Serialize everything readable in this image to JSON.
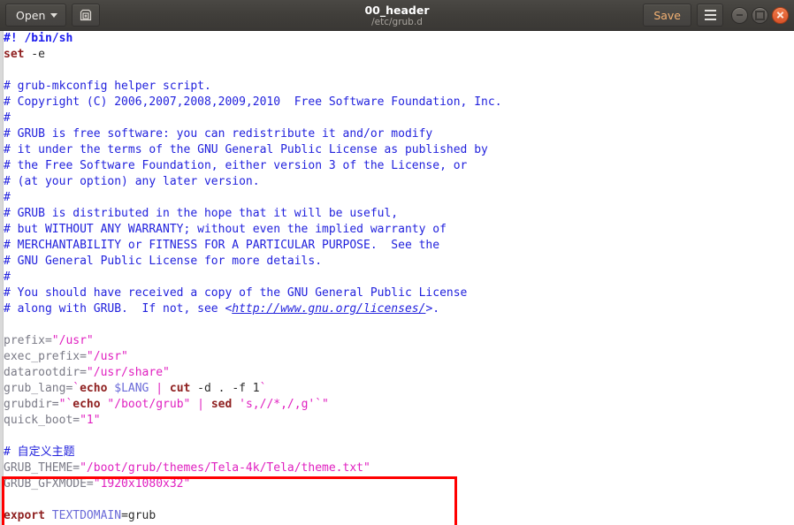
{
  "titlebar": {
    "open_label": "Open",
    "save_label": "Save",
    "title": "00_header",
    "subtitle": "/etc/grub.d",
    "icons": {
      "dropdown": "chevron-down-icon",
      "saveas": "save-as-icon",
      "menu": "hamburger-menu-icon",
      "minimize": "minimize-icon",
      "maximize": "maximize-icon",
      "close": "close-icon"
    }
  },
  "annotation": {
    "color": "#ff0000",
    "shape": "rectangle",
    "note": "highlighted custom theme configuration block"
  },
  "editor": {
    "language": "shell",
    "colors": {
      "comment": "#2222dd",
      "keyword": "#8f2020",
      "string": "#e020c0",
      "variable": "#7a7a86",
      "shell_variable": "#6a6ad8",
      "background": "#ffffff"
    },
    "lines": [
      {
        "n": 1,
        "tokens": [
          {
            "t": "#! /bin/sh",
            "c": "shb"
          }
        ]
      },
      {
        "n": 2,
        "tokens": [
          {
            "t": "set",
            "c": "kw"
          },
          {
            "t": " -e",
            "c": "plain"
          }
        ]
      },
      {
        "n": 3,
        "tokens": []
      },
      {
        "n": 4,
        "tokens": [
          {
            "t": "# grub-mkconfig helper script.",
            "c": "cmt"
          }
        ]
      },
      {
        "n": 5,
        "tokens": [
          {
            "t": "# Copyright (C) 2006,2007,2008,2009,2010  Free Software Foundation, Inc.",
            "c": "cmt"
          }
        ]
      },
      {
        "n": 6,
        "tokens": [
          {
            "t": "#",
            "c": "cmt"
          }
        ]
      },
      {
        "n": 7,
        "tokens": [
          {
            "t": "# GRUB is free software: you can redistribute it and/or modify",
            "c": "cmt"
          }
        ]
      },
      {
        "n": 8,
        "tokens": [
          {
            "t": "# it under the terms of the GNU General Public License as published by",
            "c": "cmt"
          }
        ]
      },
      {
        "n": 9,
        "tokens": [
          {
            "t": "# the Free Software Foundation, either version 3 of the License, or",
            "c": "cmt"
          }
        ]
      },
      {
        "n": 10,
        "tokens": [
          {
            "t": "# (at your option) any later version.",
            "c": "cmt"
          }
        ]
      },
      {
        "n": 11,
        "tokens": [
          {
            "t": "#",
            "c": "cmt"
          }
        ]
      },
      {
        "n": 12,
        "tokens": [
          {
            "t": "# GRUB is distributed in the hope that it will be useful,",
            "c": "cmt"
          }
        ]
      },
      {
        "n": 13,
        "tokens": [
          {
            "t": "# but WITHOUT ANY WARRANTY; without even the implied warranty of",
            "c": "cmt"
          }
        ]
      },
      {
        "n": 14,
        "tokens": [
          {
            "t": "# MERCHANTABILITY or FITNESS FOR A PARTICULAR PURPOSE.  See the",
            "c": "cmt"
          }
        ]
      },
      {
        "n": 15,
        "tokens": [
          {
            "t": "# GNU General Public License for more details.",
            "c": "cmt"
          }
        ]
      },
      {
        "n": 16,
        "tokens": [
          {
            "t": "#",
            "c": "cmt"
          }
        ]
      },
      {
        "n": 17,
        "tokens": [
          {
            "t": "# You should have received a copy of the GNU General Public License",
            "c": "cmt"
          }
        ]
      },
      {
        "n": 18,
        "tokens": [
          {
            "t": "# along with GRUB.  If not, see <",
            "c": "cmt"
          },
          {
            "t": "http://www.gnu.org/licenses/",
            "c": "lnk"
          },
          {
            "t": ">.",
            "c": "cmt"
          }
        ]
      },
      {
        "n": 19,
        "tokens": []
      },
      {
        "n": 20,
        "tokens": [
          {
            "t": "prefix=",
            "c": "var"
          },
          {
            "t": "\"/usr\"",
            "c": "str"
          }
        ]
      },
      {
        "n": 21,
        "tokens": [
          {
            "t": "exec_prefix=",
            "c": "var"
          },
          {
            "t": "\"/usr\"",
            "c": "str"
          }
        ]
      },
      {
        "n": 22,
        "tokens": [
          {
            "t": "datarootdir=",
            "c": "var"
          },
          {
            "t": "\"/usr/share\"",
            "c": "str"
          }
        ]
      },
      {
        "n": 23,
        "tokens": [
          {
            "t": "grub_lang=",
            "c": "var"
          },
          {
            "t": "`",
            "c": "str"
          },
          {
            "t": "echo",
            "c": "kw"
          },
          {
            "t": " ",
            "c": "plain"
          },
          {
            "t": "$LANG",
            "c": "dvar"
          },
          {
            "t": " ",
            "c": "plain"
          },
          {
            "t": "|",
            "c": "str"
          },
          {
            "t": " ",
            "c": "plain"
          },
          {
            "t": "cut",
            "c": "kw"
          },
          {
            "t": " -d . -f 1",
            "c": "plain"
          },
          {
            "t": "`",
            "c": "str"
          }
        ]
      },
      {
        "n": 24,
        "tokens": [
          {
            "t": "grubdir=",
            "c": "var"
          },
          {
            "t": "\"`",
            "c": "str"
          },
          {
            "t": "echo",
            "c": "kw"
          },
          {
            "t": " ",
            "c": "plain"
          },
          {
            "t": "\"/boot/grub\"",
            "c": "str"
          },
          {
            "t": " ",
            "c": "plain"
          },
          {
            "t": "|",
            "c": "str"
          },
          {
            "t": " ",
            "c": "plain"
          },
          {
            "t": "sed",
            "c": "kw"
          },
          {
            "t": " ",
            "c": "plain"
          },
          {
            "t": "'s,//*,/,g'",
            "c": "str"
          },
          {
            "t": "`\"",
            "c": "str"
          }
        ]
      },
      {
        "n": 25,
        "tokens": [
          {
            "t": "quick_boot=",
            "c": "var"
          },
          {
            "t": "\"1\"",
            "c": "str"
          }
        ]
      },
      {
        "n": 26,
        "tokens": []
      },
      {
        "n": 27,
        "tokens": [
          {
            "t": "# 自定义主题",
            "c": "cmt"
          }
        ]
      },
      {
        "n": 28,
        "tokens": [
          {
            "t": "GRUB_THEME=",
            "c": "var"
          },
          {
            "t": "\"/boot/grub/themes/Tela-4k/Tela/theme.txt\"",
            "c": "str"
          }
        ]
      },
      {
        "n": 29,
        "tokens": [
          {
            "t": "GRUB_GFXMODE=",
            "c": "var"
          },
          {
            "t": "\"1920x1080x32\"",
            "c": "str"
          }
        ]
      },
      {
        "n": 30,
        "tokens": []
      },
      {
        "n": 31,
        "tokens": [
          {
            "t": "export",
            "c": "kw"
          },
          {
            "t": " ",
            "c": "plain"
          },
          {
            "t": "TEXTDOMAIN",
            "c": "dvar"
          },
          {
            "t": "=grub",
            "c": "plain"
          }
        ]
      }
    ]
  }
}
